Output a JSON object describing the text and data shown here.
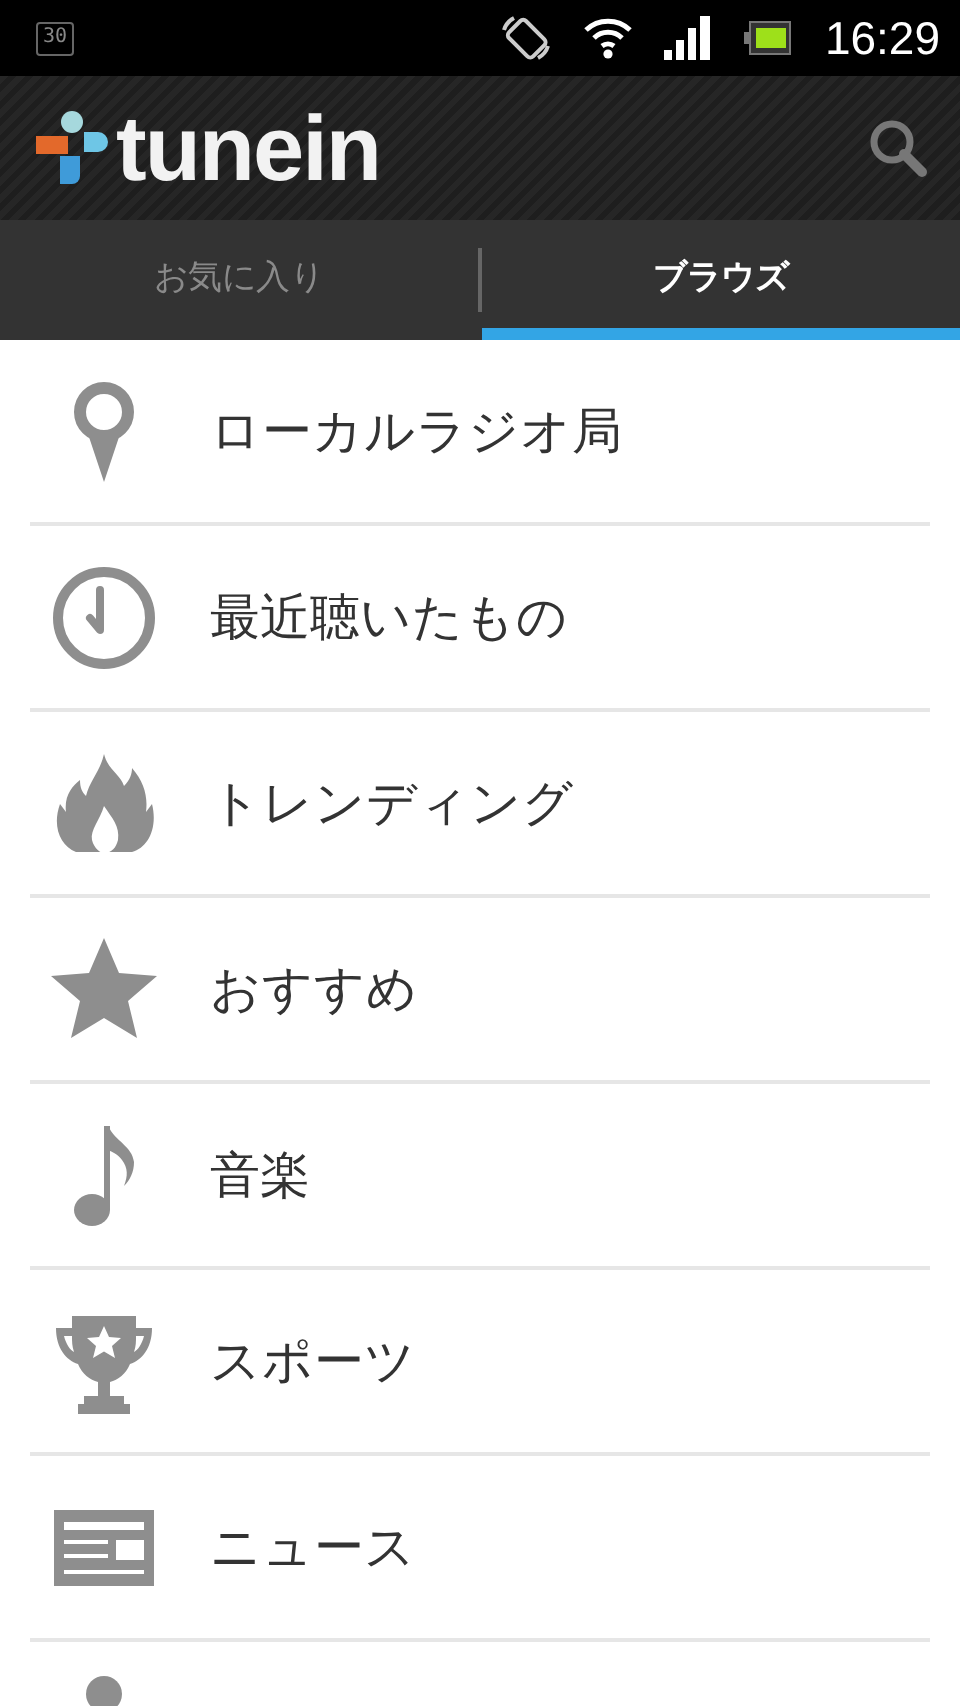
{
  "status_bar": {
    "calendar_date": "30",
    "time": "16:29"
  },
  "app_bar": {
    "logo_text": "tunein"
  },
  "tabs": [
    {
      "label": "お気に入り",
      "selected": false
    },
    {
      "label": "ブラウズ",
      "selected": true
    }
  ],
  "menu_items": [
    {
      "label": "ローカルラジオ局"
    },
    {
      "label": "最近聴いたもの"
    },
    {
      "label": "トレンディング"
    },
    {
      "label": "おすすめ"
    },
    {
      "label": "音楽"
    },
    {
      "label": "スポーツ"
    },
    {
      "label": "ニュース"
    }
  ]
}
